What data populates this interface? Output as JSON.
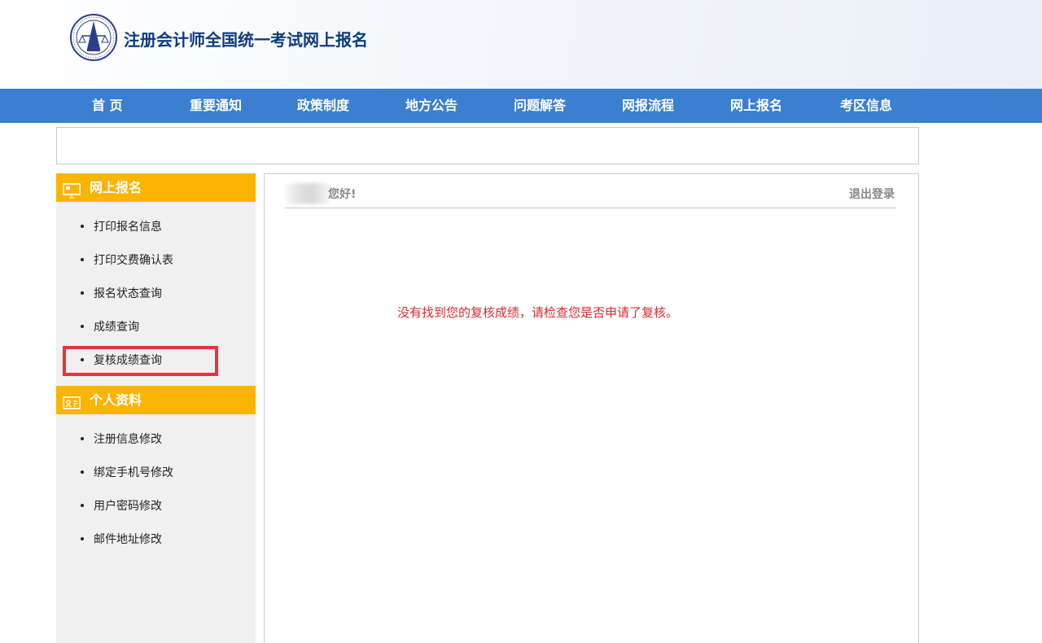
{
  "header": {
    "site_title": "注册会计师全国统一考试网上报名",
    "logo_icon": "cicpa-emblem-icon"
  },
  "nav": {
    "items": [
      "首 页",
      "重要通知",
      "政策制度",
      "地方公告",
      "问题解答",
      "网报流程",
      "网上报名",
      "考区信息"
    ]
  },
  "sidebar": {
    "section1": {
      "title": "网上报名",
      "icon": "monitor-icon",
      "items": [
        "打印报名信息",
        "打印交费确认表",
        "报名状态查询",
        "成绩查询",
        "复核成绩查询"
      ]
    },
    "section2": {
      "title": "个人资料",
      "icon": "id-card-icon",
      "items": [
        "注册信息修改",
        "绑定手机号修改",
        "用户密码修改",
        "邮件地址修改"
      ]
    }
  },
  "main": {
    "greeting": "您好!",
    "logout_label": "退出登录",
    "message": "没有找到您的复核成绩，请检查您是否申请了复核。"
  },
  "colors": {
    "nav_bg": "#3a7fd0",
    "sidebar_head_bg": "#fbb400",
    "message_text": "#d92a2a",
    "highlight_border": "#e8333a"
  }
}
